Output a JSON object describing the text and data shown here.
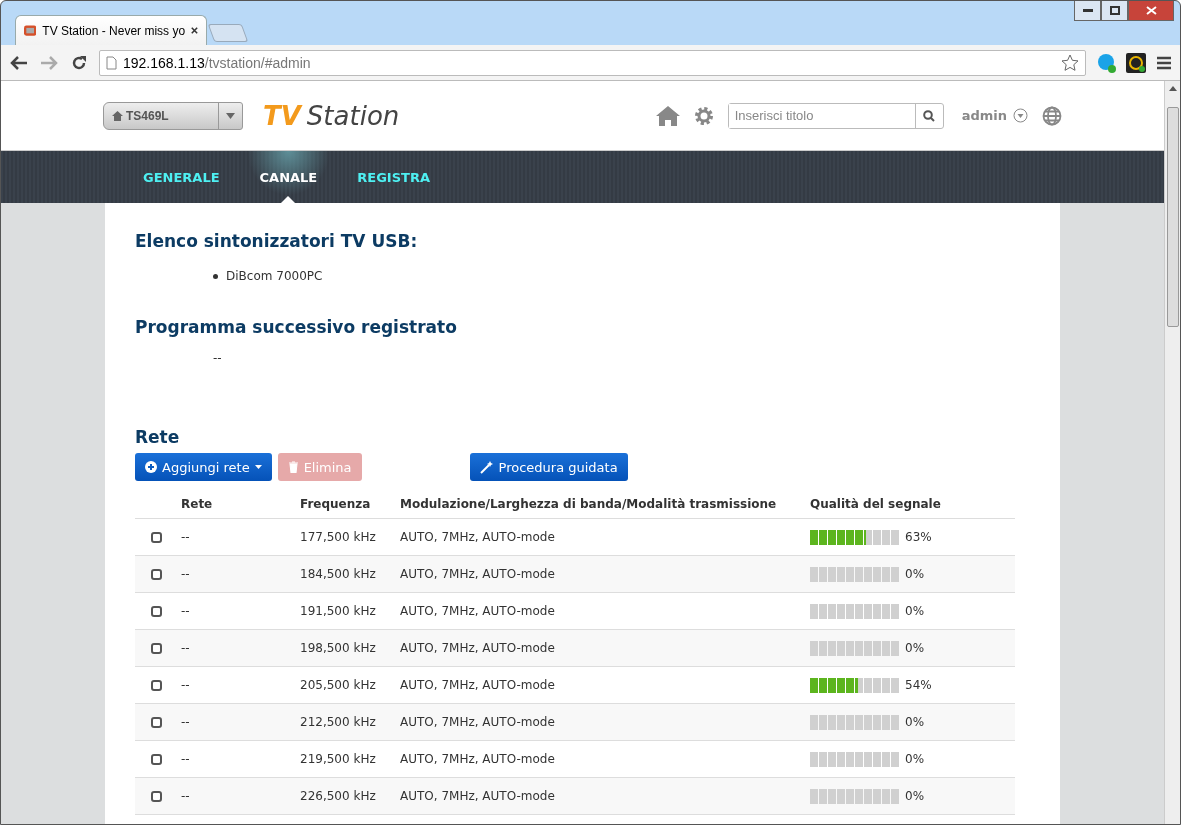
{
  "browser": {
    "tab_title": "TV Station - Never miss yo",
    "url_host": "192.168.1.13",
    "url_path": "/tvstation/#admin"
  },
  "header": {
    "device": "TS469L",
    "logo_tv": "TV",
    "logo_station": "Station",
    "search": {
      "placeholder": "Inserisci titolo"
    },
    "user": "admin"
  },
  "nav": [
    {
      "label": "GENERALE",
      "selected": false
    },
    {
      "label": "CANALE",
      "selected": true
    },
    {
      "label": "REGISTRA",
      "selected": false
    }
  ],
  "tuners": {
    "title": "Elenco sintonizzatori TV USB:",
    "items": [
      "DiBcom 7000PC"
    ]
  },
  "next_program": {
    "title": "Programma successivo registrato",
    "value": "--"
  },
  "network": {
    "title": "Rete",
    "buttons": [
      {
        "label": "Aggiungi rete",
        "kind": "add",
        "disabled": false
      },
      {
        "label": "Elimina",
        "kind": "delete",
        "disabled": true
      },
      {
        "label": "Procedura guidata",
        "kind": "wizard",
        "disabled": false
      }
    ],
    "columns": [
      "Rete",
      "Frequenza",
      "Modulazione/Larghezza di banda/Modalità trasmissione",
      "Qualità del segnale"
    ],
    "rows": [
      {
        "checked": false,
        "name": "--",
        "frequency": "177,500 kHz",
        "modulation": "AUTO, 7MHz, AUTO-mode",
        "level": 0.63,
        "quality": "63%"
      },
      {
        "checked": false,
        "name": "--",
        "frequency": "184,500 kHz",
        "modulation": "AUTO, 7MHz, AUTO-mode",
        "level": 0,
        "quality": "0%"
      },
      {
        "checked": false,
        "name": "--",
        "frequency": "191,500 kHz",
        "modulation": "AUTO, 7MHz, AUTO-mode",
        "level": 0,
        "quality": "0%"
      },
      {
        "checked": false,
        "name": "--",
        "frequency": "198,500 kHz",
        "modulation": "AUTO, 7MHz, AUTO-mode",
        "level": 0,
        "quality": "0%"
      },
      {
        "checked": false,
        "name": "--",
        "frequency": "205,500 kHz",
        "modulation": "AUTO, 7MHz, AUTO-mode",
        "level": 0.54,
        "quality": "54%"
      },
      {
        "checked": false,
        "name": "--",
        "frequency": "212,500 kHz",
        "modulation": "AUTO, 7MHz, AUTO-mode",
        "level": 0,
        "quality": "0%"
      },
      {
        "checked": false,
        "name": "--",
        "frequency": "219,500 kHz",
        "modulation": "AUTO, 7MHz, AUTO-mode",
        "level": 0,
        "quality": "0%"
      },
      {
        "checked": false,
        "name": "--",
        "frequency": "226,500 kHz",
        "modulation": "AUTO, 7MHz, AUTO-mode",
        "level": 0,
        "quality": "0%"
      }
    ]
  }
}
